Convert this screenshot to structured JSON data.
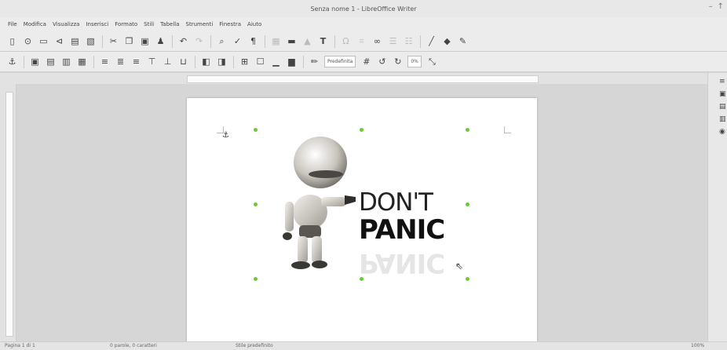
{
  "window": {
    "title": "Senza nome 1 - LibreOffice Writer",
    "controls": [
      "–",
      "↑"
    ]
  },
  "menu": [
    "File",
    "Modifica",
    "Visualizza",
    "Inserisci",
    "Formato",
    "Stili",
    "Tabella",
    "Strumenti",
    "Finestra",
    "Aiuto"
  ],
  "toolbar1": [
    "new-doc",
    "open",
    "save",
    "export-pdf",
    "print",
    "print-preview",
    "cut",
    "copy",
    "paste",
    "clone",
    "undo",
    "redo",
    "find",
    "spell",
    "formatting-marks",
    "insert-table",
    "insert-image",
    "insert-chart",
    "insert-text",
    "insert-special",
    "insert-field",
    "insert-hyperlink",
    "insert-note",
    "track-changes",
    "line",
    "shapes",
    "draw"
  ],
  "toolbar2": {
    "style_value": "Predefinita",
    "zoom_value": "0%"
  },
  "document": {
    "image_text_line1": "DON'T",
    "image_text_line2": "PANIC",
    "image_text_reflection": "PANIC"
  },
  "statusbar": {
    "page": "Pagina 1 di 1",
    "words": "0 parole, 0 caratteri",
    "style": "Stile predefinito",
    "zoom": "100%"
  }
}
